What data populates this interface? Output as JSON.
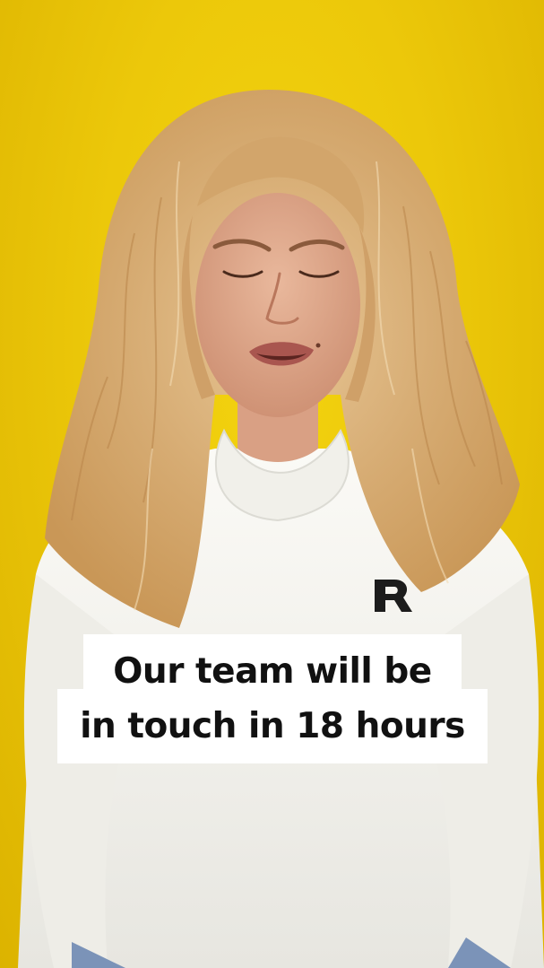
{
  "caption": {
    "line1": "Our team will be",
    "line2": "in touch in 18 hours"
  },
  "colors": {
    "background": "#ecc80a",
    "caption_box": "#ffffff",
    "caption_text": "#111111",
    "hoodie": "#f5f4ef",
    "hair": "#d9b27c"
  },
  "scene": {
    "subject": "person-with-curly-blonde-hair",
    "clothing": "white-hoodie",
    "logo": "hoodie-logo-icon"
  }
}
